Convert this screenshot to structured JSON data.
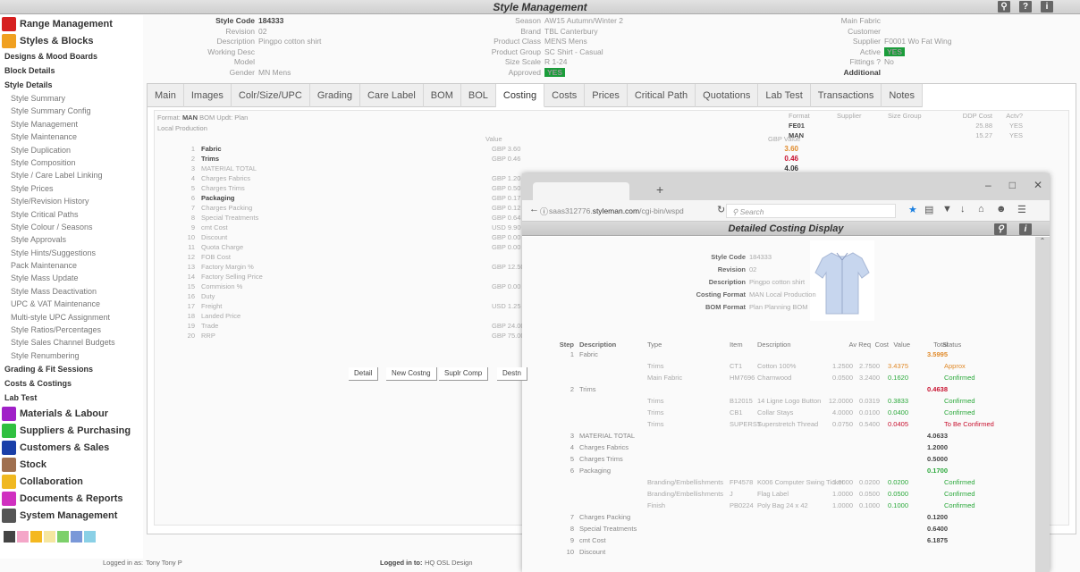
{
  "window": {
    "title": "Style Management",
    "icons": [
      "search-icon",
      "help-icon",
      "info-icon"
    ]
  },
  "sidebar": {
    "modules_top": [
      {
        "label": "Range Management",
        "icon": "target-icon",
        "color": "#d62020"
      },
      {
        "label": "Styles & Blocks",
        "icon": "shirt-icon",
        "color": "#f0a020"
      }
    ],
    "sections": [
      {
        "label": "Designs & Mood Boards"
      },
      {
        "label": "Block Details"
      },
      {
        "label": "Style Details"
      }
    ],
    "style_items": [
      "Style Summary",
      "Style Summary Config",
      "Style Management",
      "Style Maintenance",
      "Style Duplication",
      "Style Composition",
      "Style / Care Label Linking",
      "Style Prices",
      "Style/Revision History",
      "Style Critical Paths",
      "Style Colour / Seasons",
      "Style Approvals",
      "Style Hints/Suggestions",
      "Pack Maintenance",
      "Style Mass Update",
      "Style Mass Deactivation",
      "UPC & VAT Maintenance",
      "Multi-style UPC Assignment",
      "Style Ratios/Percentages",
      "Style Sales Channel Budgets",
      "Style Renumbering"
    ],
    "sections_bottom": [
      "Grading & Fit Sessions",
      "Costs & Costings",
      "Lab Test"
    ],
    "modules_bottom": [
      {
        "label": "Materials & Labour",
        "icon": "grid-icon",
        "color": "#a020c8"
      },
      {
        "label": "Suppliers & Purchasing",
        "icon": "chart-icon",
        "color": "#30c040"
      },
      {
        "label": "Customers & Sales",
        "icon": "handshake-icon",
        "color": "#1a3fa8"
      },
      {
        "label": "Stock",
        "icon": "box-icon",
        "color": "#a07050"
      },
      {
        "label": "Collaboration",
        "icon": "people-icon",
        "color": "#f0b820"
      },
      {
        "label": "Documents & Reports",
        "icon": "folder-icon",
        "color": "#d030c0"
      },
      {
        "label": "System Management",
        "icon": "wrench-icon",
        "color": "#555555"
      }
    ],
    "tools": [
      "search-icon",
      "bank-icon",
      "clock-icon",
      "warning-icon",
      "export-icon",
      "columns-icon",
      "arrow-icon"
    ]
  },
  "header": {
    "col1": [
      {
        "label": "Style Code",
        "value": "184333",
        "bold": true
      },
      {
        "label": "Revision",
        "value": "02"
      },
      {
        "label": "Description",
        "value": "Pingpo cotton shirt"
      },
      {
        "label": "Working Desc",
        "value": ""
      },
      {
        "label": "Model",
        "value": ""
      },
      {
        "label": "Gender",
        "value": "MN Mens"
      }
    ],
    "col2": [
      {
        "label": "Season",
        "value": "AW15 Autumn/Winter 2"
      },
      {
        "label": "Brand",
        "value": "TBL Canterbury"
      },
      {
        "label": "Product Class",
        "value": "MENS Mens"
      },
      {
        "label": "Product Group",
        "value": "SC Shirt - Casual"
      },
      {
        "label": "Size Scale",
        "value": "R 1-24"
      },
      {
        "label": "Approved",
        "value": "YES",
        "badge": true
      }
    ],
    "col3": [
      {
        "label": "Main Fabric",
        "value": ""
      },
      {
        "label": "Customer",
        "value": ""
      },
      {
        "label": "Supplier",
        "value": "F0001 Wo Fat Wing"
      },
      {
        "label": "Active",
        "value": "YES",
        "badge": true
      },
      {
        "label": "Fittings ?",
        "value": "No"
      },
      {
        "label": "Additional",
        "value": "",
        "bold": true
      }
    ]
  },
  "tabs": [
    "Main",
    "Images",
    "Colr/Size/UPC",
    "Grading",
    "Care Label",
    "BOM",
    "BOL",
    "Costing",
    "Costs",
    "Prices",
    "Critical Path",
    "Quotations",
    "Lab Test",
    "Transactions",
    "Notes"
  ],
  "active_tab": "Costing",
  "costing": {
    "format_label": "Format:",
    "format_value": "MAN",
    "bom_updt": "BOM Updt: Plan",
    "local": "Local Production",
    "value_header": "Value",
    "gbp_value_header": "GBP Value",
    "rows": [
      {
        "n": "1",
        "desc": "Fabric",
        "value": "GBP 3.60",
        "gbp": "3.60",
        "bold": true
      },
      {
        "n": "2",
        "desc": "Trims",
        "value": "GBP 0.46",
        "gbp": "0.46",
        "bold": true
      },
      {
        "n": "3",
        "desc": "MATERIAL TOTAL",
        "value": "",
        "gbp": "4.06"
      },
      {
        "n": "4",
        "desc": "Charges Fabrics",
        "value": "GBP 1.20"
      },
      {
        "n": "5",
        "desc": "Charges Trims",
        "value": "GBP 0.50"
      },
      {
        "n": "6",
        "desc": "Packaging",
        "value": "GBP 0.17",
        "bold": true
      },
      {
        "n": "7",
        "desc": "Charges Packing",
        "value": "GBP 0.12"
      },
      {
        "n": "8",
        "desc": "Special Treatments",
        "value": "GBP 0.64"
      },
      {
        "n": "9",
        "desc": "cmt Cost",
        "value": "USD 9.90"
      },
      {
        "n": "10",
        "desc": "Discount",
        "value": "GBP 0.00"
      },
      {
        "n": "11",
        "desc": "Quota Charge",
        "value": "GBP 0.00"
      },
      {
        "n": "12",
        "desc": "FOB Cost",
        "value": ""
      },
      {
        "n": "13",
        "desc": "Factory Margin %",
        "value": "GBP 12.50"
      },
      {
        "n": "14",
        "desc": "Factory Selling Price",
        "value": ""
      },
      {
        "n": "15",
        "desc": "Commision %",
        "value": "GBP 0.00"
      },
      {
        "n": "16",
        "desc": "Duty",
        "value": ""
      },
      {
        "n": "17",
        "desc": "Freight",
        "value": "USD 1.25"
      },
      {
        "n": "18",
        "desc": "Landed Price",
        "value": ""
      },
      {
        "n": "19",
        "desc": "Trade",
        "value": "GBP 24.00"
      },
      {
        "n": "20",
        "desc": "RRP",
        "value": "GBP 75.00"
      }
    ],
    "formats_table": {
      "headers": [
        "Format",
        "Supplier",
        "Size Group",
        "DDP Cost",
        "Actv?"
      ],
      "rows": [
        {
          "format": "FE01",
          "supplier": "",
          "size_group": "",
          "ddp": "25.88",
          "actv": "YES"
        },
        {
          "format": "MAN",
          "supplier": "",
          "size_group": "",
          "ddp": "15.27",
          "actv": "YES"
        }
      ]
    },
    "buttons": [
      "Detail",
      "New Costng",
      "Suplr Comp",
      "Destn"
    ]
  },
  "footer": {
    "logged_in_as_label": "Logged in as:",
    "logged_in_as": "Tony  Tony P",
    "logged_in_to_label": "Logged in to:",
    "logged_in_to": "HQ OSL Design"
  },
  "popup": {
    "new_tab": "+",
    "url_prefix": "saas312776.",
    "url_domain": "styleman.com",
    "url_path": "/cgi-bin/wspd",
    "search_placeholder": "Search",
    "title": "Detailed Costing Display",
    "info": [
      {
        "label": "Style Code",
        "value": "184333"
      },
      {
        "label": "Revision",
        "value": "02"
      },
      {
        "label": "Description",
        "value": "Pingpo cotton shirt"
      },
      {
        "label": "Costing Format",
        "value": "MAN Local Production"
      },
      {
        "label": "BOM Format",
        "value": "Plan Planning BOM"
      }
    ],
    "headers": [
      "Step",
      "Description",
      "Type",
      "Item",
      "Description",
      "Av Req",
      "Cost",
      "Value",
      "Total",
      "Status"
    ],
    "rows": [
      {
        "step": "1",
        "desc": "Fabric",
        "total": "3.5995",
        "total_color": "orange"
      },
      {
        "type": "Trims",
        "item": "CT1",
        "idesc": "Cotton 100%",
        "avreq": "1.2500",
        "cost": "2.7500",
        "value": "3.4375",
        "value_color": "orange",
        "status": "Approx",
        "status_color": "orange"
      },
      {
        "type": "Main Fabric",
        "item": "HM7696",
        "idesc": "Charnwood",
        "avreq": "0.0500",
        "cost": "3.2400",
        "value": "0.1620",
        "value_color": "green",
        "status": "Confirmed",
        "status_color": "green"
      },
      {
        "step": "2",
        "desc": "Trims",
        "total": "0.4638",
        "total_color": "red"
      },
      {
        "type": "Trims",
        "item": "B12015",
        "idesc": "14 Ligne Logo Button",
        "avreq": "12.0000",
        "cost": "0.0319",
        "value": "0.3833",
        "value_color": "green",
        "status": "Confirmed",
        "status_color": "green"
      },
      {
        "type": "Trims",
        "item": "CB1",
        "idesc": "Collar Stays",
        "avreq": "4.0000",
        "cost": "0.0100",
        "value": "0.0400",
        "value_color": "green",
        "status": "Confirmed",
        "status_color": "green"
      },
      {
        "type": "Trims",
        "item": "SUPERST",
        "idesc": "Superstretch Thread",
        "avreq": "0.0750",
        "cost": "0.5400",
        "value": "0.0405",
        "value_color": "red",
        "status": "To Be Confirmed",
        "status_color": "red"
      },
      {
        "step": "3",
        "desc": "MATERIAL TOTAL",
        "total": "4.0633",
        "total_color": "dark"
      },
      {
        "step": "4",
        "desc": "Charges Fabrics",
        "total": "1.2000",
        "total_color": "dark"
      },
      {
        "step": "5",
        "desc": "Charges Trims",
        "total": "0.5000",
        "total_color": "dark"
      },
      {
        "step": "6",
        "desc": "Packaging",
        "total": "0.1700",
        "total_color": "green"
      },
      {
        "type": "Branding/Embellishments",
        "item": "FP4578",
        "idesc": "K006 Computer Swing Ticket",
        "avreq": "1.0000",
        "cost": "0.0200",
        "value": "0.0200",
        "value_color": "green",
        "status": "Confirmed",
        "status_color": "green"
      },
      {
        "type": "Branding/Embellishments",
        "item": "J",
        "idesc": "Flag Label",
        "avreq": "1.0000",
        "cost": "0.0500",
        "value": "0.0500",
        "value_color": "green",
        "status": "Confirmed",
        "status_color": "green"
      },
      {
        "type": "Finish",
        "item": "PB0224",
        "idesc": "Poly Bag 24 x 42",
        "avreq": "1.0000",
        "cost": "0.1000",
        "value": "0.1000",
        "value_color": "green",
        "status": "Confirmed",
        "status_color": "green"
      },
      {
        "step": "7",
        "desc": "Charges Packing",
        "total": "0.1200",
        "total_color": "dark"
      },
      {
        "step": "8",
        "desc": "Special Treatments",
        "total": "0.6400",
        "total_color": "dark"
      },
      {
        "step": "9",
        "desc": "cmt Cost",
        "total": "6.1875",
        "total_color": "dark"
      },
      {
        "step": "10",
        "desc": "Discount",
        "total": "",
        "total_color": "dark"
      }
    ]
  }
}
